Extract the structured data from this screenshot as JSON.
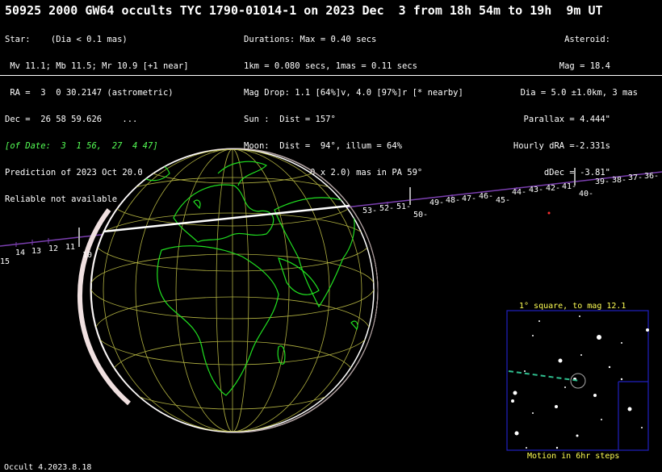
{
  "title": "50925 2000 GW64 occults TYC 1790-01014-1 on 2023 Dec  3 from 18h 54m to 19h  9m UT",
  "star": {
    "lines": [
      "Star:    (Dia < 0.1 mas)",
      " Mv 11.1; Mb 11.5; Mr 10.9 [+1 near]",
      " RA =  3  0 30.2147 (astrometric)",
      "Dec =  26 58 59.626    ..."
    ],
    "date_line": "[of Date:  3  1 56,  27  4 47]",
    "prediction": "Prediction of 2023 Oct 20.0",
    "reliable": "Reliable not available"
  },
  "durations": {
    "lines": [
      "Durations: Max = 0.40 secs",
      "1km = 0.080 secs, 1mas = 0.11 secs",
      "Mag Drop: 1.1 [64%]v, 4.0 [97%]r [* nearby]",
      "Sun :  Dist = 157°",
      "Moon:  Dist =  94°, illum = 64%",
      "1σ Err: ±(15.0 x 2.0) mas in PA 59°"
    ]
  },
  "asteroid": {
    "lines": [
      "Asteroid:",
      "Mag = 18.4",
      "Dia = 5.0 ±1.0km, 3 mas",
      "Parallax = 4.444\"",
      "Hourly dRA =-2.331s",
      "dDec = -3.81\""
    ]
  },
  "track_labels": {
    "left": [
      "15",
      "14",
      "13",
      "12",
      "11",
      "10"
    ],
    "right": [
      "53-",
      "52-",
      "51-",
      "50-",
      "49-",
      "48-",
      "47-",
      "46-",
      "45-",
      "44-",
      "43-",
      "42-",
      "41-",
      "40-",
      "39-",
      "38-",
      "37-",
      "36-"
    ]
  },
  "finder": {
    "title": "1° square, to mag 12.1",
    "caption": "Motion in 6hr steps"
  },
  "version": "Occult 4.2023.8.18",
  "colors": {
    "track": "#7b3fb0",
    "grid": "#b0b040",
    "coast": "#20e020",
    "path": "#ffffff",
    "finder_box": "#2020c0"
  }
}
